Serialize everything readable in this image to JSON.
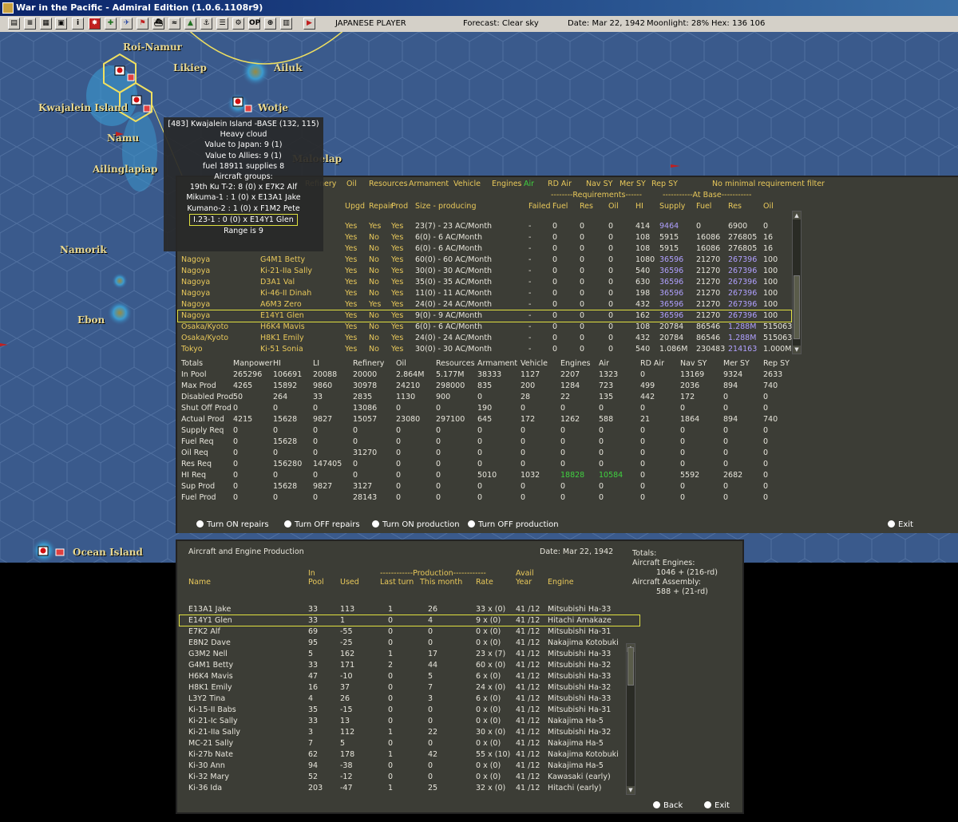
{
  "window": {
    "title": "War in the Pacific - Admiral Edition (1.0.6.1108r9)"
  },
  "toolbar": {
    "player": "JAPANESE PLAYER",
    "forecast": "Forecast: Clear sky",
    "date": "Date: Mar 22, 1942",
    "moonlight": "Moonlight: 28%",
    "hex": "Hex: 136 106"
  },
  "map": {
    "places": [
      "Roi-Namur",
      "Likiep",
      "Ailuk",
      "Kwajalein Island",
      "Wotje",
      "Namu",
      "Ailinglapiap",
      "Maloelap",
      "Namorik",
      "Ebon",
      "Ocean Island"
    ]
  },
  "tooltip": {
    "lines": [
      "[483] Kwajalein Island -BASE (132, 115)",
      "Heavy cloud",
      "Value to Japan: 9 (1)",
      "Value to Allies: 9 (1)",
      "fuel 18911  supplies 8",
      "Aircraft groups:",
      "19th Ku T-2: 8 (0) x E7K2 Alf",
      "Mikuma-1 : 1 (0) x E13A1 Jake",
      "Kumano-2 : 1 (0) x F1M2 Pete",
      "I.23-1 : 0 (0) x E14Y1 Glen",
      "Range is 9"
    ]
  },
  "industry": {
    "header_top": [
      "Refinery",
      "Oil",
      "Resources",
      "Armament",
      "Vehicle",
      "Engines",
      "Air",
      "RD Air",
      "Nav SY",
      "Mer SY",
      "Rep SY",
      "No minimal requirement filter"
    ],
    "header_sub": [
      "Upgd",
      "Repair",
      "Prod",
      "Size - producing",
      "Failed",
      "Fuel",
      "Res",
      "Oil",
      "HI",
      "Supply",
      "Fuel",
      "Res",
      "Oil"
    ],
    "requirements_label": "--------Requirements------",
    "atbase_label": "-----------At Base-----------",
    "rows": [
      [
        "",
        "",
        "Yes",
        "Yes",
        "Yes",
        "23(7) - 23 AC/Month",
        "-",
        "0",
        "0",
        "0",
        "414",
        "9464",
        "0",
        "6900",
        "0"
      ],
      [
        "",
        "",
        "Yes",
        "No",
        "Yes",
        "6(0) - 6 AC/Month",
        "-",
        "0",
        "0",
        "0",
        "108",
        "5915",
        "16086",
        "276805",
        "16"
      ],
      [
        "",
        "",
        "Yes",
        "No",
        "Yes",
        "6(0) - 6 AC/Month",
        "-",
        "0",
        "0",
        "0",
        "108",
        "5915",
        "16086",
        "276805",
        "16"
      ],
      [
        "Nagoya",
        "G4M1 Betty",
        "Yes",
        "No",
        "Yes",
        "60(0) - 60 AC/Month",
        "-",
        "0",
        "0",
        "0",
        "1080",
        "36596",
        "21270",
        "267396",
        "100"
      ],
      [
        "Nagoya",
        "Ki-21-IIa Sally",
        "Yes",
        "No",
        "Yes",
        "30(0) - 30 AC/Month",
        "-",
        "0",
        "0",
        "0",
        "540",
        "36596",
        "21270",
        "267396",
        "100"
      ],
      [
        "Nagoya",
        "D3A1 Val",
        "Yes",
        "No",
        "Yes",
        "35(0) - 35 AC/Month",
        "-",
        "0",
        "0",
        "0",
        "630",
        "36596",
        "21270",
        "267396",
        "100"
      ],
      [
        "Nagoya",
        "Ki-46-II Dinah",
        "Yes",
        "No",
        "Yes",
        "11(0) - 11 AC/Month",
        "-",
        "0",
        "0",
        "0",
        "198",
        "36596",
        "21270",
        "267396",
        "100"
      ],
      [
        "Nagoya",
        "A6M3 Zero",
        "Yes",
        "Yes",
        "Yes",
        "24(0) - 24 AC/Month",
        "-",
        "0",
        "0",
        "0",
        "432",
        "36596",
        "21270",
        "267396",
        "100"
      ],
      [
        "Nagoya",
        "E14Y1 Glen",
        "Yes",
        "No",
        "Yes",
        "9(0) - 9 AC/Month",
        "-",
        "0",
        "0",
        "0",
        "162",
        "36596",
        "21270",
        "267396",
        "100"
      ],
      [
        "Osaka/Kyoto",
        "H6K4 Mavis",
        "Yes",
        "No",
        "Yes",
        "6(0) - 6 AC/Month",
        "-",
        "0",
        "0",
        "0",
        "108",
        "20784",
        "86546",
        "1.288M",
        "515063"
      ],
      [
        "Osaka/Kyoto",
        "H8K1 Emily",
        "Yes",
        "No",
        "Yes",
        "24(0) - 24 AC/Month",
        "-",
        "0",
        "0",
        "0",
        "432",
        "20784",
        "86546",
        "1.288M",
        "515063"
      ],
      [
        "Tokyo",
        "Ki-51 Sonia",
        "Yes",
        "No",
        "Yes",
        "30(0) - 30 AC/Month",
        "-",
        "0",
        "0",
        "0",
        "540",
        "1.086M",
        "230483",
        "214163",
        "1.000M"
      ]
    ],
    "totals_header": [
      "Totals",
      "Manpower",
      "HI",
      "LI",
      "Refinery",
      "Oil",
      "Resources",
      "Armament",
      "Vehicle",
      "Engines",
      "Air",
      "RD Air",
      "Nav SY",
      "Mer SY",
      "Rep SY"
    ],
    "totals": [
      [
        "In Pool",
        "265296",
        "106691",
        "20088",
        "20000",
        "2.864M",
        "5.177M",
        "38333",
        "1127",
        "2207",
        "1323",
        "0",
        "13169",
        "9324",
        "2633"
      ],
      [
        "Max Prod",
        "4265",
        "15892",
        "9860",
        "30978",
        "24210",
        "298000",
        "835",
        "200",
        "1284",
        "723",
        "499",
        "2036",
        "894",
        "740"
      ],
      [
        "Disabled Prod",
        "50",
        "264",
        "33",
        "2835",
        "1130",
        "900",
        "0",
        "28",
        "22",
        "135",
        "442",
        "172",
        "0",
        "0"
      ],
      [
        "Shut Off Prod",
        "0",
        "0",
        "0",
        "13086",
        "0",
        "0",
        "190",
        "0",
        "0",
        "0",
        "0",
        "0",
        "0",
        "0"
      ],
      [
        "Actual Prod",
        "4215",
        "15628",
        "9827",
        "15057",
        "23080",
        "297100",
        "645",
        "172",
        "1262",
        "588",
        "21",
        "1864",
        "894",
        "740"
      ],
      [
        "Supply Req",
        "0",
        "0",
        "0",
        "0",
        "0",
        "0",
        "0",
        "0",
        "0",
        "0",
        "0",
        "0",
        "0",
        "0"
      ],
      [
        "Fuel Req",
        "0",
        "15628",
        "0",
        "0",
        "0",
        "0",
        "0",
        "0",
        "0",
        "0",
        "0",
        "0",
        "0",
        "0"
      ],
      [
        "Oil Req",
        "0",
        "0",
        "0",
        "31270",
        "0",
        "0",
        "0",
        "0",
        "0",
        "0",
        "0",
        "0",
        "0",
        "0"
      ],
      [
        "Res Req",
        "0",
        "156280",
        "147405",
        "0",
        "0",
        "0",
        "0",
        "0",
        "0",
        "0",
        "0",
        "0",
        "0",
        "0"
      ],
      [
        "HI Req",
        "0",
        "0",
        "0",
        "0",
        "0",
        "0",
        "5010",
        "1032",
        "18828",
        "10584",
        "0",
        "5592",
        "2682",
        "0"
      ],
      [
        "Sup Prod",
        "0",
        "15628",
        "9827",
        "3127",
        "0",
        "0",
        "0",
        "0",
        "0",
        "0",
        "0",
        "0",
        "0",
        "0"
      ],
      [
        "Fuel Prod",
        "0",
        "0",
        "0",
        "28143",
        "0",
        "0",
        "0",
        "0",
        "0",
        "0",
        "0",
        "0",
        "0",
        "0"
      ]
    ],
    "buttons": [
      "Turn ON repairs",
      "Turn OFF repairs",
      "Turn ON production",
      "Turn OFF production",
      "Exit"
    ]
  },
  "aircraft": {
    "title": "Aircraft and Engine Production",
    "date": "Date: Mar 22, 1942",
    "totals_label": "Totals:",
    "engines_label": "Aircraft Engines:",
    "engines_value": "1046 + (216-rd)",
    "assembly_label": "Aircraft Assembly:",
    "assembly_value": "588 + (21-rd)",
    "header1": [
      "In",
      "------------Production------------",
      "Avail"
    ],
    "header2": [
      "Name",
      "Pool",
      "Used",
      "Last turn",
      "This month",
      "Rate",
      "Year",
      "Engine"
    ],
    "rows": [
      [
        "E13A1 Jake",
        "33",
        "113",
        "1",
        "26",
        "33 x (0)",
        "41 /12",
        "Mitsubishi Ha-33"
      ],
      [
        "E14Y1 Glen",
        "33",
        "1",
        "0",
        "4",
        "9 x (0)",
        "41 /12",
        "Hitachi Amakaze"
      ],
      [
        "E7K2 Alf",
        "69",
        "-55",
        "0",
        "0",
        "0 x (0)",
        "41 /12",
        "Mitsubishi Ha-31"
      ],
      [
        "E8N2 Dave",
        "95",
        "-25",
        "0",
        "0",
        "0 x (0)",
        "41 /12",
        "Nakajima Kotobuki"
      ],
      [
        "G3M2 Nell",
        "5",
        "162",
        "1",
        "17",
        "23 x (7)",
        "41 /12",
        "Mitsubishi Ha-33"
      ],
      [
        "G4M1 Betty",
        "33",
        "171",
        "2",
        "44",
        "60 x (0)",
        "41 /12",
        "Mitsubishi Ha-32"
      ],
      [
        "H6K4 Mavis",
        "47",
        "-10",
        "0",
        "5",
        "6 x (0)",
        "41 /12",
        "Mitsubishi Ha-33"
      ],
      [
        "H8K1 Emily",
        "16",
        "37",
        "0",
        "7",
        "24 x (0)",
        "41 /12",
        "Mitsubishi Ha-32"
      ],
      [
        "L3Y2 Tina",
        "4",
        "26",
        "0",
        "3",
        "6 x (0)",
        "41 /12",
        "Mitsubishi Ha-33"
      ],
      [
        "Ki-15-II Babs",
        "35",
        "-15",
        "0",
        "0",
        "0 x (0)",
        "41 /12",
        "Mitsubishi Ha-31"
      ],
      [
        "Ki-21-Ic Sally",
        "33",
        "13",
        "0",
        "0",
        "0 x (0)",
        "41 /12",
        "Nakajima Ha-5"
      ],
      [
        "Ki-21-IIa Sally",
        "3",
        "112",
        "1",
        "22",
        "30 x (0)",
        "41 /12",
        "Mitsubishi Ha-32"
      ],
      [
        "MC-21 Sally",
        "7",
        "5",
        "0",
        "0",
        "0 x (0)",
        "41 /12",
        "Nakajima Ha-5"
      ],
      [
        "Ki-27b Nate",
        "62",
        "178",
        "1",
        "42",
        "55 x (10)",
        "41 /12",
        "Nakajima Kotobuki"
      ],
      [
        "Ki-30 Ann",
        "94",
        "-38",
        "0",
        "0",
        "0 x (0)",
        "41 /12",
        "Nakajima Ha-5"
      ],
      [
        "Ki-32 Mary",
        "52",
        "-12",
        "0",
        "0",
        "0 x (0)",
        "41 /12",
        "Kawasaki (early)"
      ],
      [
        "Ki-36 Ida",
        "203",
        "-47",
        "1",
        "25",
        "32 x (0)",
        "41 /12",
        "Hitachi (early)"
      ]
    ],
    "buttons": [
      "Back",
      "Exit"
    ]
  }
}
